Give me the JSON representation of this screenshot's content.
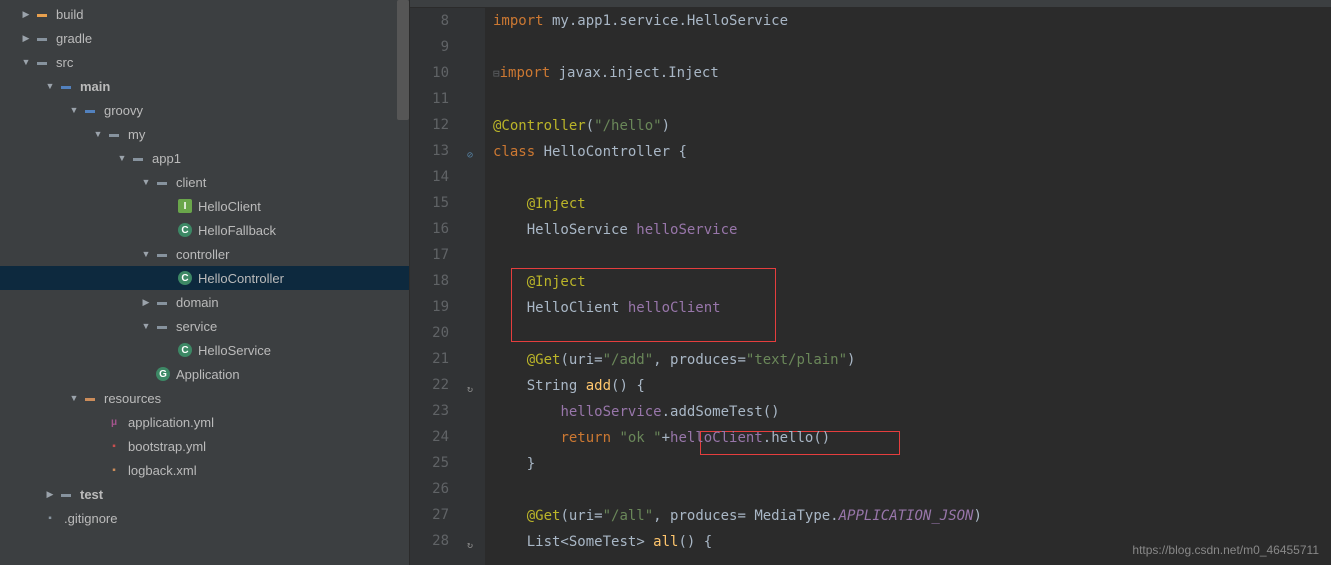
{
  "tree": {
    "build": "build",
    "gradle": "gradle",
    "src": "src",
    "main": "main",
    "groovy": "groovy",
    "my": "my",
    "app1": "app1",
    "client": "client",
    "helloClient": "HelloClient",
    "helloFallback": "HelloFallback",
    "controller": "controller",
    "helloController": "HelloController",
    "domain": "domain",
    "service": "service",
    "helloService": "HelloService",
    "application": "Application",
    "resources": "resources",
    "applicationYml": "application.yml",
    "bootstrapYml": "bootstrap.yml",
    "logbackXml": "logback.xml",
    "test": "test",
    "gitignore": ".gitignore"
  },
  "lines": {
    "8": "8",
    "9": "9",
    "10": "10",
    "11": "11",
    "12": "12",
    "13": "13",
    "14": "14",
    "15": "15",
    "16": "16",
    "17": "17",
    "18": "18",
    "19": "19",
    "20": "20",
    "21": "21",
    "22": "22",
    "23": "23",
    "24": "24",
    "25": "25",
    "26": "26",
    "27": "27",
    "28": "28"
  },
  "code": {
    "l8_import": "import",
    "l8_pkg": " my.app1.service.HelloService",
    "l10_import": "import",
    "l10_pkg": " javax.inject.Inject",
    "l12_anno": "@Controller",
    "l12_paren_open": "(",
    "l12_str": "\"/hello\"",
    "l12_paren_close": ")",
    "l13_class": "class ",
    "l13_name": "HelloController ",
    "l13_brace": "{",
    "l15_indent": "    ",
    "l15_anno": "@Inject",
    "l16_indent": "    ",
    "l16_type": "HelloService ",
    "l16_var": "helloService",
    "l18_indent": "    ",
    "l18_anno": "@Inject",
    "l19_indent": "    ",
    "l19_type": "HelloClient ",
    "l19_var": "helloClient",
    "l21_indent": "    ",
    "l21_anno": "@Get",
    "l21_paren_open": "(",
    "l21_p1": "uri=",
    "l21_str1": "\"/add\"",
    "l21_comma": ", ",
    "l21_p2": "produces=",
    "l21_str2": "\"text/plain\"",
    "l21_paren_close": ")",
    "l22_indent": "    ",
    "l22_type": "String ",
    "l22_fn": "add",
    "l22_parens": "() {",
    "l23_indent": "        ",
    "l23_obj": "helloService",
    "l23_dot": ".",
    "l23_method": "addSomeTest()",
    "l24_indent": "        ",
    "l24_return": "return ",
    "l24_str": "\"ok \"",
    "l24_plus": "+",
    "l24_obj": "helloClient",
    "l24_dot": ".",
    "l24_method": "hello()",
    "l25_indent": "    ",
    "l25_brace": "}",
    "l27_indent": "    ",
    "l27_anno": "@Get",
    "l27_paren_open": "(",
    "l27_p1": "uri=",
    "l27_str1": "\"/all\"",
    "l27_comma": ", ",
    "l27_p2": "produces= ",
    "l27_type": "MediaType.",
    "l27_const": "APPLICATION_JSON",
    "l27_paren_close": ")",
    "l28_indent": "    ",
    "l28_type1": "List<",
    "l28_type2": "SomeTest",
    "l28_type3": "> ",
    "l28_fn": "all",
    "l28_parens": "() {"
  },
  "watermark": "https://blog.csdn.net/m0_46455711"
}
